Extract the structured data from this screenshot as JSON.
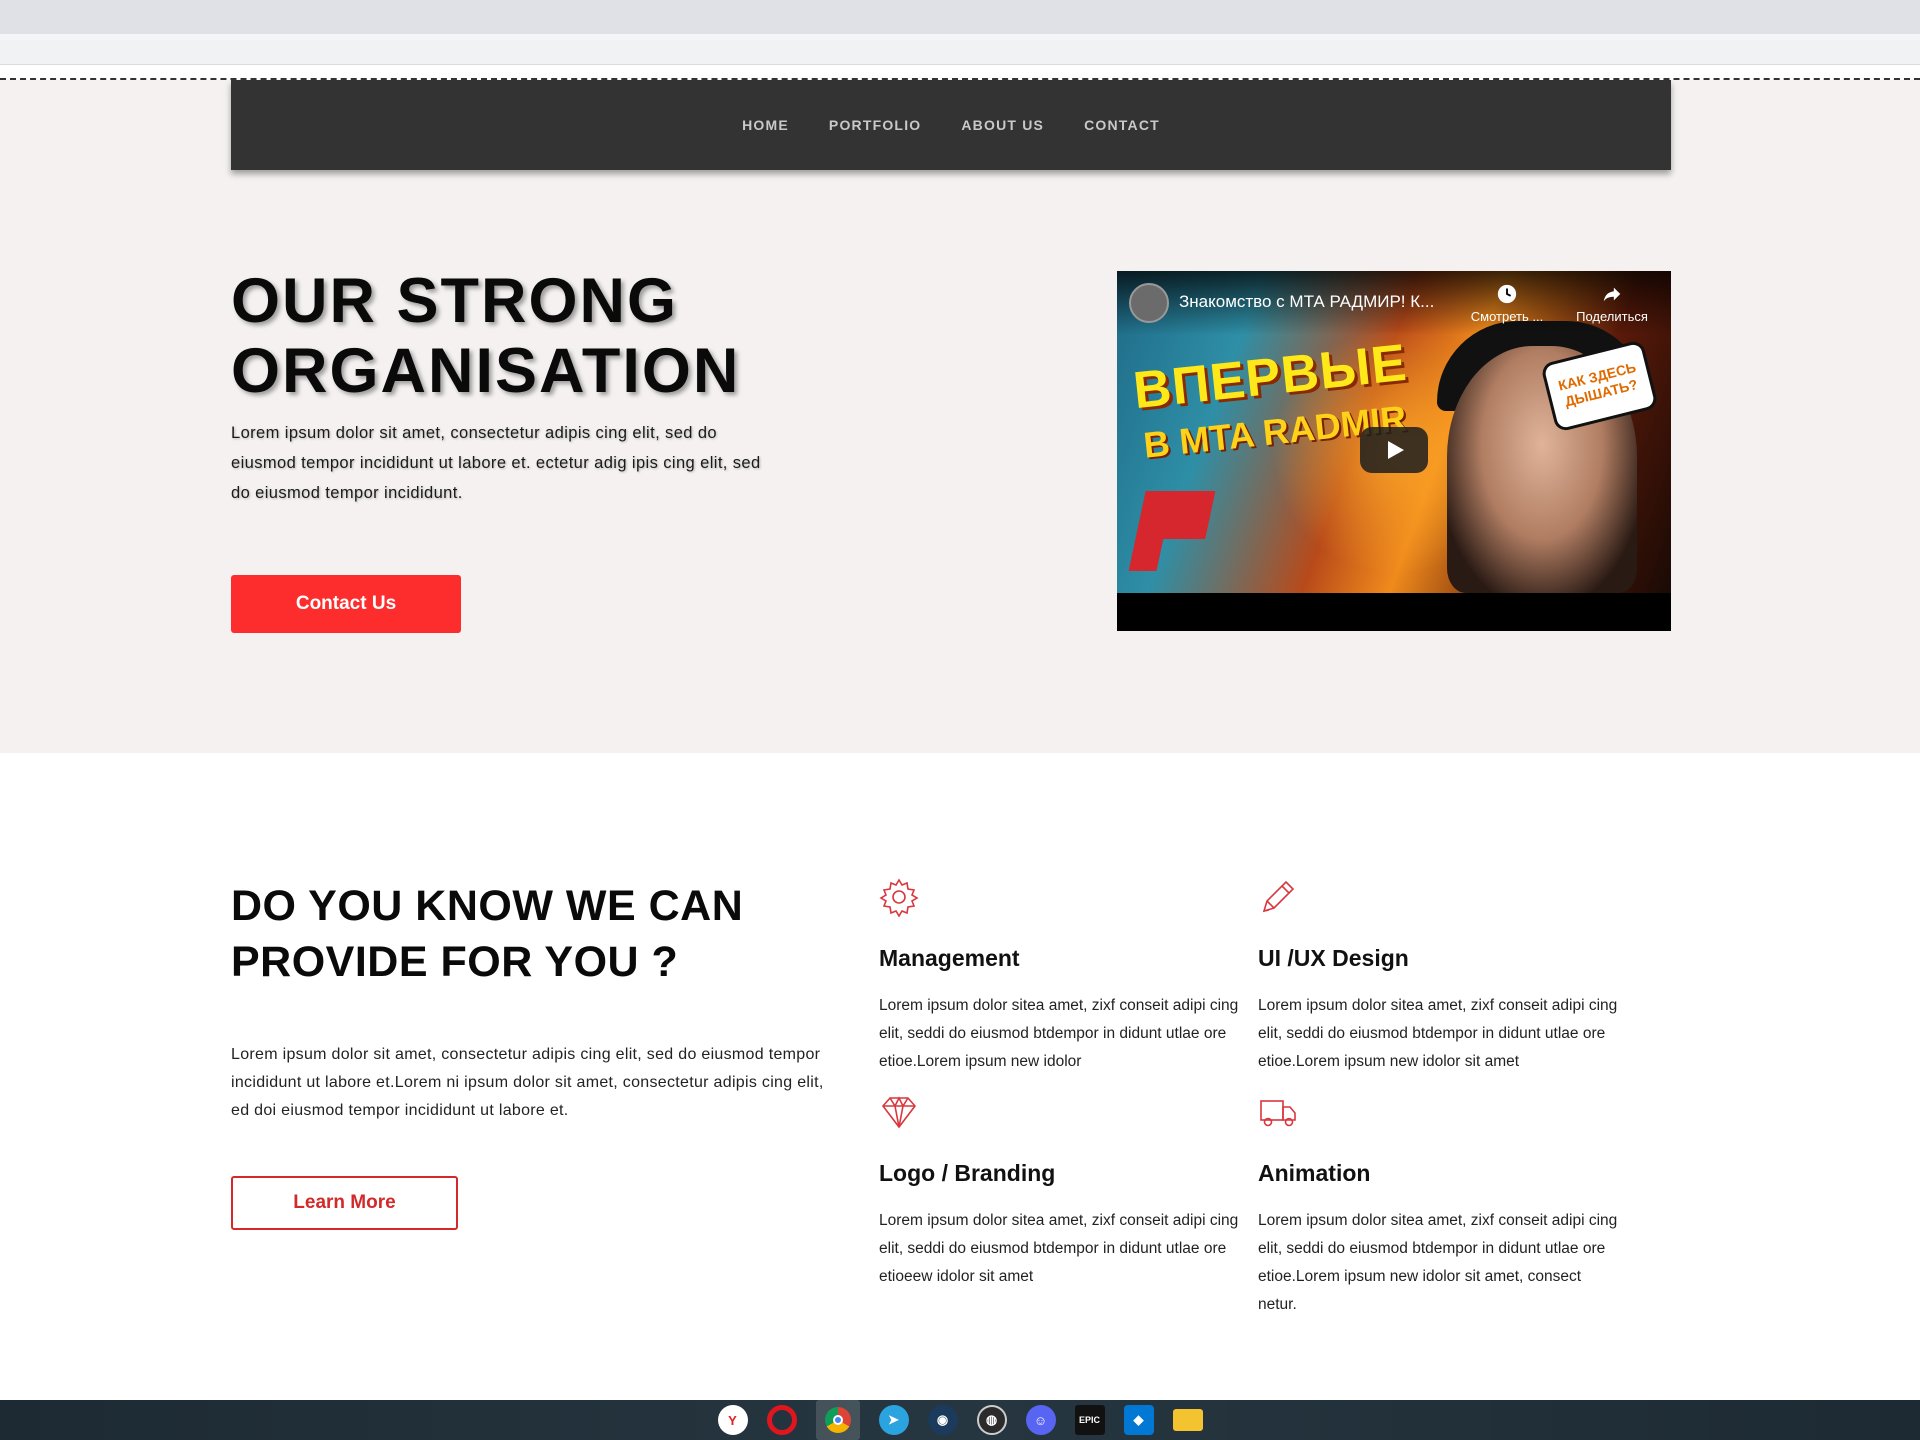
{
  "nav": {
    "links": [
      "HOME",
      "PORTFOLIO",
      "ABOUT US",
      "CONTACT"
    ]
  },
  "hero": {
    "title_line1": "OUR STRONG",
    "title_line2": "ORGANISATION",
    "text": "Lorem ipsum dolor sit amet, consectetur adipis cing elit, sed do eiusmod tempor incididunt ut labore et. ectetur adig ipis cing elit, sed do eiusmod tempor incididunt.",
    "button_label": "Contact Us"
  },
  "video": {
    "title": "Знакомство с МТА РАДМИР! К...",
    "watch_later": "Смотреть ...",
    "share": "Поделиться",
    "thumb_line1": "ВПЕРВЫЕ",
    "thumb_line2": "В MTA RADMIR",
    "thumb_bubble": "КАК ЗДЕСЬ ДЫШАТЬ?"
  },
  "features": {
    "title_line1": "DO YOU KNOW WE CAN",
    "title_line2": "PROVIDE FOR YOU ?",
    "text": "Lorem ipsum dolor sit amet, consectetur adipis cing elit, sed do eiusmod tempor incididunt ut labore et.Lorem ni ipsum dolor sit amet, consectetur adipis cing elit, ed doi eiusmod tempor incididunt ut labore et.",
    "button_label": "Learn More",
    "items": [
      {
        "icon": "gear-icon",
        "title": "Management",
        "text": "Lorem ipsum dolor sitea amet, zixf conseit adipi cing elit, seddi do eiusmod btdempor in didunt utlae ore etioe.Lorem ipsum new idolor"
      },
      {
        "icon": "pencil-icon",
        "title": "UI /UX Design",
        "text": "Lorem ipsum dolor sitea amet, zixf conseit adipi cing elit, seddi do eiusmod btdempor in didunt utlae ore etioe.Lorem ipsum new idolor sit amet"
      },
      {
        "icon": "diamond-icon",
        "title": "Logo / Branding",
        "text": "Lorem ipsum dolor sitea amet, zixf conseit adipi cing elit, seddi do eiusmod btdempor in didunt utlae ore etioeew idolor sit amet"
      },
      {
        "icon": "truck-icon",
        "title": "Animation",
        "text": "Lorem ipsum dolor sitea amet, zixf conseit adipi cing elit, seddi do eiusmod btdempor in didunt utlae ore etioe.Lorem ipsum new idolor sit amet, consect netur."
      }
    ]
  },
  "colors": {
    "accent": "#fd2d2d",
    "nav_bg": "#333333",
    "hero_bg": "#f4f1f0",
    "icon_stroke": "#d9363e"
  },
  "taskbar": {
    "icons": [
      "yandex-browser-icon",
      "opera-icon",
      "chrome-icon",
      "telegram-icon",
      "steam-icon",
      "obs-icon",
      "discord-icon",
      "epic-games-icon",
      "vscode-icon",
      "file-explorer-icon"
    ]
  }
}
